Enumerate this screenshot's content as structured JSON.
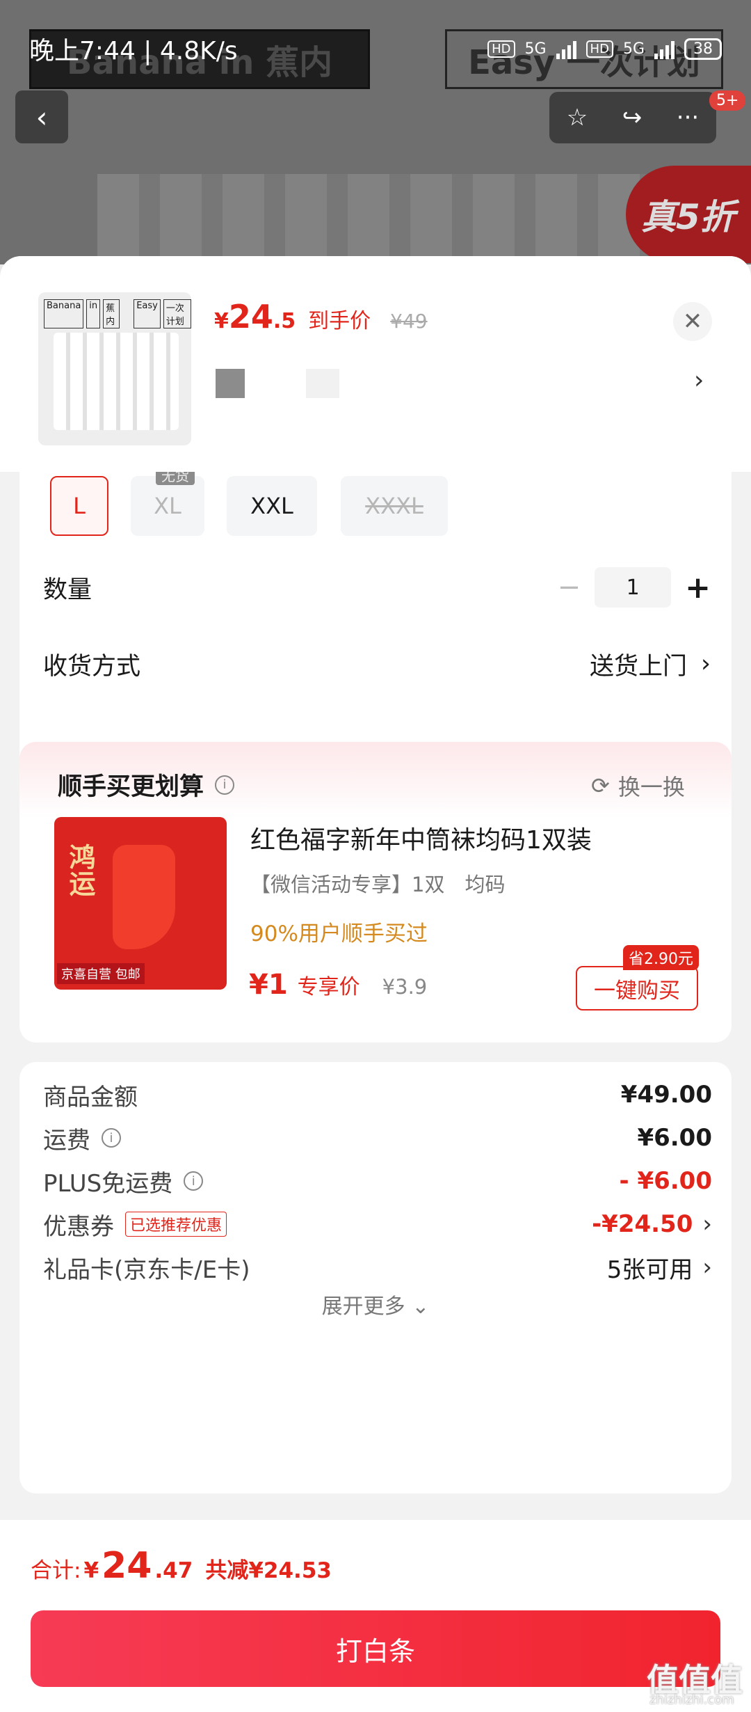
{
  "status_bar": {
    "time": "晚上7:44 | 4.8K/s",
    "hd1": "HD",
    "net1": "5G",
    "hd2": "HD",
    "net2": "5G",
    "battery": "38"
  },
  "background_page": {
    "logo_left": "Banana  in  蕉内",
    "logo_right": "Easy  一次计划",
    "back_icon": "chevron-left-icon",
    "more_badge": "5+",
    "promo": "真5折"
  },
  "product_header": {
    "thumb_brand_1": "Banana",
    "thumb_brand_2": "in",
    "thumb_brand_3": "蕉内",
    "thumb_brand_4": "Easy",
    "thumb_brand_5": "一次计划",
    "price_symbol": "¥",
    "price_int": "24",
    "price_dec": ".5",
    "price_tag": "到手价",
    "price_old": "¥49",
    "close_icon": "close-icon"
  },
  "sizes": {
    "oos_label": "无货",
    "items": [
      "L",
      "XL",
      "XXL",
      "XXXL"
    ]
  },
  "quantity": {
    "label": "数量",
    "value": "1",
    "minus": "−",
    "plus": "+"
  },
  "delivery": {
    "label": "收货方式",
    "value": "送货上门"
  },
  "addon": {
    "title": "顺手买更划算",
    "swap_label": "换一换",
    "image_text": "鸿运",
    "image_tag": "京喜自营 包邮",
    "name": "红色福字新年中筒袜均码1双装",
    "sub": "【微信活动专享】1双　均码",
    "pct": "90%用户顺手买过",
    "price": "¥1",
    "price_tag": "专享价",
    "price_old": "¥3.9",
    "save_badge": "省2.90元",
    "buy_label": "一键购买"
  },
  "summary": {
    "goods_label": "商品金额",
    "goods_value": "¥49.00",
    "freight_label": "运费",
    "freight_value": "¥6.00",
    "plus_label": "PLUS免运费",
    "plus_value": "- ¥6.00",
    "coupon_label": "优惠券",
    "coupon_tag": "已选推荐优惠",
    "coupon_value": "-¥24.50",
    "giftcard_label": "礼品卡(京东卡/E卡)",
    "giftcard_value": "5张可用",
    "expand_label": "展开更多 ⌄"
  },
  "footer": {
    "total_label": "合计:",
    "total_symbol": "¥",
    "total_int": "24",
    "total_dec": ".47",
    "total_reduce": "共减¥24.53",
    "pay_label": "打白条"
  },
  "watermark": {
    "main": "值值值",
    "sub": "zhizhizhi.com"
  },
  "colors": {
    "accent": "#e1251b",
    "button": "#f1242e",
    "highlight": "#d48a1e"
  }
}
